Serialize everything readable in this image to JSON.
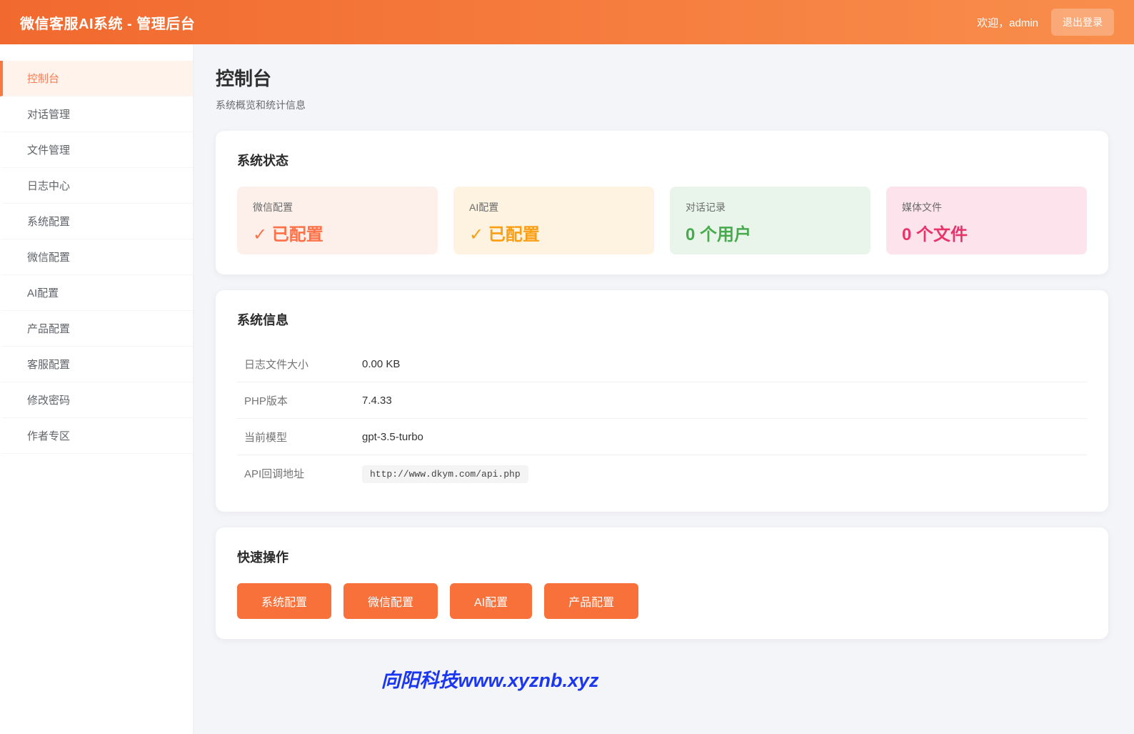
{
  "header": {
    "title": "微信客服AI系统 - 管理后台",
    "welcome": "欢迎，admin",
    "logout_label": "退出登录"
  },
  "sidebar": {
    "items": [
      {
        "label": "控制台",
        "active": true
      },
      {
        "label": "对话管理",
        "active": false
      },
      {
        "label": "文件管理",
        "active": false
      },
      {
        "label": "日志中心",
        "active": false
      },
      {
        "label": "系统配置",
        "active": false
      },
      {
        "label": "微信配置",
        "active": false
      },
      {
        "label": "AI配置",
        "active": false
      },
      {
        "label": "产品配置",
        "active": false
      },
      {
        "label": "客服配置",
        "active": false
      },
      {
        "label": "修改密码",
        "active": false
      },
      {
        "label": "作者专区",
        "active": false
      }
    ]
  },
  "page": {
    "title": "控制台",
    "subtitle": "系统概览和统计信息"
  },
  "status_card": {
    "title": "系统状态",
    "stats": [
      {
        "label": "微信配置",
        "value": "✓ 已配置",
        "color": "#fd7149",
        "bg": "#fdf0ea"
      },
      {
        "label": "AI配置",
        "value": "✓ 已配置",
        "color": "#fb9e12",
        "bg": "#fdf3e0"
      },
      {
        "label": "对话记录",
        "value": "0 个用户",
        "color": "#47ab4e",
        "bg": "#e9f5ea"
      },
      {
        "label": "媒体文件",
        "value": "0 个文件",
        "color": "#e8336b",
        "bg": "#fce3ec"
      }
    ]
  },
  "info_card": {
    "title": "系统信息",
    "rows": [
      {
        "label": "日志文件大小",
        "value": "0.00 KB"
      },
      {
        "label": "PHP版本",
        "value": "7.4.33"
      },
      {
        "label": "当前模型",
        "value": "gpt-3.5-turbo"
      },
      {
        "label": "API回调地址",
        "value": "http://www.dkym.com/api.php"
      }
    ]
  },
  "actions_card": {
    "title": "快速操作",
    "buttons": [
      {
        "label": "系统配置"
      },
      {
        "label": "微信配置"
      },
      {
        "label": "AI配置"
      },
      {
        "label": "产品配置"
      }
    ]
  },
  "footer": {
    "watermark": "向阳科技www.xyznb.xyz"
  },
  "colors": {
    "header_gradient_start": "#f1692e",
    "header_gradient_end": "#f98e4c",
    "accent": "#f8713a",
    "active_menu_text": "#fb7a50",
    "active_menu_bg": "#fff3ec",
    "watermark_blue": "#1b36f0"
  }
}
